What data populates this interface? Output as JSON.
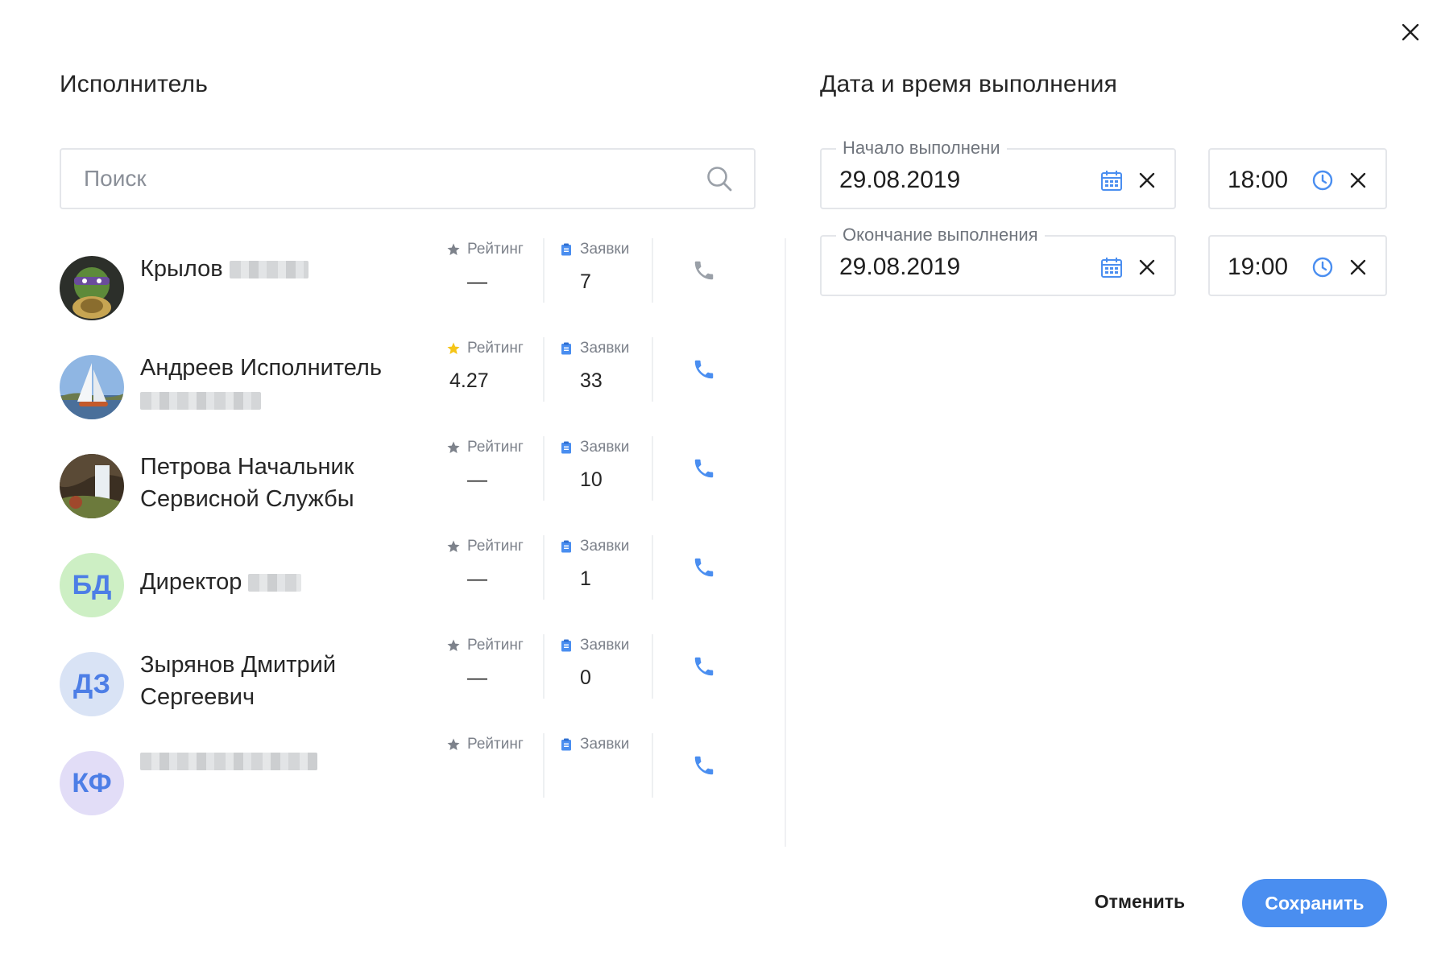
{
  "performer": {
    "title": "Исполнитель",
    "search_placeholder": "Поиск",
    "rating_label": "Рейтинг",
    "orders_label": "Заявки",
    "people": [
      {
        "name": "Крылов",
        "rating": "—",
        "orders": "7",
        "avatar_type": "photo",
        "phone_color": "#9aa0a8"
      },
      {
        "name": "Андреев Исполнитель",
        "rating": "4.27",
        "orders": "33",
        "avatar_type": "photo",
        "phone_color": "#4a8ef0"
      },
      {
        "name": "Петрова Начальник Сервисной Службы",
        "rating": "—",
        "orders": "10",
        "avatar_type": "photo",
        "phone_color": "#4a8ef0"
      },
      {
        "name": "Директор",
        "rating": "—",
        "orders": "1",
        "avatar_type": "initials",
        "initials": "БД",
        "avatar_bg": "#cdefc4",
        "phone_color": "#4a8ef0"
      },
      {
        "name": "Зырянов Дмитрий Сергеевич",
        "rating": "—",
        "orders": "0",
        "avatar_type": "initials",
        "initials": "ДЗ",
        "avatar_bg": "#d9e3f5",
        "phone_color": "#4a8ef0"
      },
      {
        "name": "",
        "rating": "",
        "orders": "",
        "avatar_type": "initials",
        "initials": "КФ",
        "avatar_bg": "#e2ddf7",
        "phone_color": "#4a8ef0"
      }
    ]
  },
  "datetime": {
    "title": "Дата и время выполнения",
    "start_label": "Начало выполнени",
    "start_date": "29.08.2019",
    "start_time": "18:00",
    "end_label": "Окончание выполнения",
    "end_date": "29.08.2019",
    "end_time": "19:00"
  },
  "footer": {
    "cancel_label": "Отменить",
    "save_label": "Сохранить"
  },
  "colors": {
    "accent": "#4a8ef0",
    "rating_star_active": "#f5c518",
    "rating_star_inactive": "#7d828b"
  }
}
